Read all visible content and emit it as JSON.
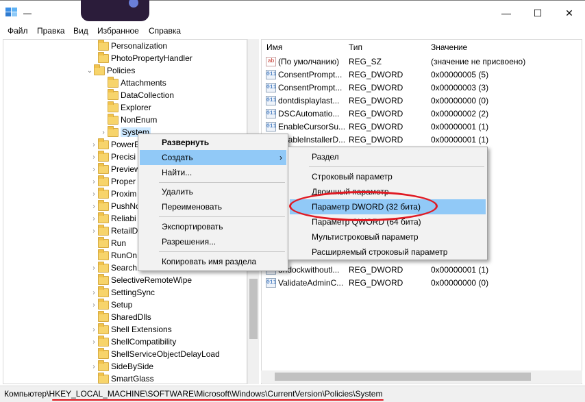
{
  "window": {
    "title": "—",
    "minimize": "—",
    "maximize": "☐",
    "close": "✕"
  },
  "menu": [
    "Файл",
    "Правка",
    "Вид",
    "Избранное",
    "Справка"
  ],
  "tree": {
    "items": [
      {
        "label": "Personalization",
        "arrow": ""
      },
      {
        "label": "PhotoPropertyHandler",
        "arrow": ""
      },
      {
        "label": "Policies",
        "arrow": "⌄"
      },
      {
        "label": "Attachments",
        "arrow": ""
      },
      {
        "label": "DataCollection",
        "arrow": ""
      },
      {
        "label": "Explorer",
        "arrow": ""
      },
      {
        "label": "NonEnum",
        "arrow": ""
      },
      {
        "label": "System",
        "arrow": "›"
      },
      {
        "label": "PowerE",
        "arrow": "›"
      },
      {
        "label": "Precisi",
        "arrow": "›"
      },
      {
        "label": "Preview",
        "arrow": "›"
      },
      {
        "label": "Proper",
        "arrow": "›"
      },
      {
        "label": "Proxim",
        "arrow": "›"
      },
      {
        "label": "PushNo",
        "arrow": "›"
      },
      {
        "label": "Reliabi",
        "arrow": "›"
      },
      {
        "label": "RetailD",
        "arrow": "›"
      },
      {
        "label": "Run",
        "arrow": ""
      },
      {
        "label": "RunOn",
        "arrow": ""
      },
      {
        "label": "Search",
        "arrow": "›"
      },
      {
        "label": "SelectiveRemoteWipe",
        "arrow": ""
      },
      {
        "label": "SettingSync",
        "arrow": "›"
      },
      {
        "label": "Setup",
        "arrow": "›"
      },
      {
        "label": "SharedDlls",
        "arrow": ""
      },
      {
        "label": "Shell Extensions",
        "arrow": "›"
      },
      {
        "label": "ShellCompatibility",
        "arrow": "›"
      },
      {
        "label": "ShellServiceObjectDelayLoad",
        "arrow": ""
      },
      {
        "label": "SideBySide",
        "arrow": "›"
      },
      {
        "label": "SmartGlass",
        "arrow": ""
      }
    ]
  },
  "list": {
    "headers": [
      "Имя",
      "Тип",
      "Значение"
    ],
    "rows": [
      {
        "icon": "ab",
        "name": "(По умолчанию)",
        "type": "REG_SZ",
        "value": "(значение не присвоено)"
      },
      {
        "icon": "011",
        "name": "ConsentPrompt...",
        "type": "REG_DWORD",
        "value": "0x00000005 (5)"
      },
      {
        "icon": "011",
        "name": "ConsentPrompt...",
        "type": "REG_DWORD",
        "value": "0x00000003 (3)"
      },
      {
        "icon": "011",
        "name": "dontdisplaylast...",
        "type": "REG_DWORD",
        "value": "0x00000000 (0)"
      },
      {
        "icon": "011",
        "name": "DSCAutomatio...",
        "type": "REG_DWORD",
        "value": "0x00000002 (2)"
      },
      {
        "icon": "011",
        "name": "EnableCursorSu...",
        "type": "REG_DWORD",
        "value": "0x00000001 (1)"
      },
      {
        "icon": "011",
        "name": "EnableInstallerD...",
        "type": "REG_DWORD",
        "value": "0x00000001 (1)"
      },
      {
        "icon": "011",
        "name": "undockwithoutl...",
        "type": "REG_DWORD",
        "value": "0x00000001 (1)"
      },
      {
        "icon": "011",
        "name": "ValidateAdminC...",
        "type": "REG_DWORD",
        "value": "0x00000000 (0)"
      }
    ]
  },
  "context_menu": {
    "items": [
      "Развернуть",
      "Создать",
      "Найти...",
      "Удалить",
      "Переименовать",
      "Экспортировать",
      "Разрешения...",
      "Копировать имя раздела"
    ],
    "submenu_arrow": "›"
  },
  "submenu": {
    "items": [
      "Раздел",
      "Строковый параметр",
      "Двоичный параметр",
      "Параметр DWORD (32 бита)",
      "Параметр QWORD (64 бита)",
      "Мультистроковый параметр",
      "Расширяемый строковый параметр"
    ]
  },
  "status": {
    "path": "Компьютер\\HKEY_LOCAL_MACHINE\\SOFTWARE\\Microsoft\\Windows\\CurrentVersion\\Policies\\System"
  },
  "colors": {
    "highlight": "#91c9f7",
    "annotation": "#e01b24"
  }
}
